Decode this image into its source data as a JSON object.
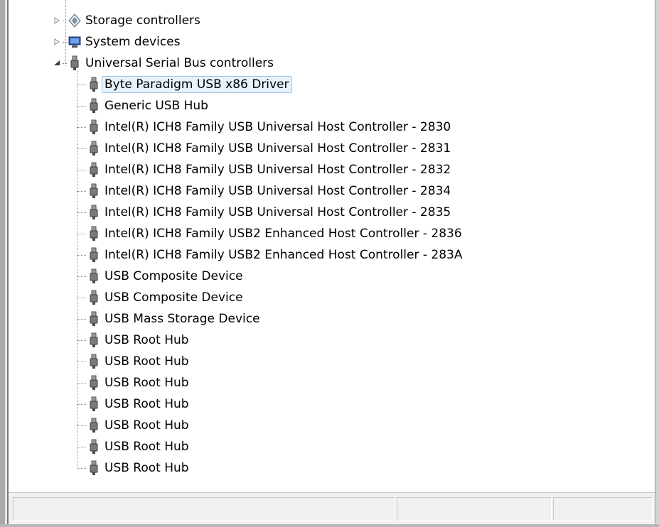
{
  "tree": {
    "categories": [
      {
        "label": "Storage controllers",
        "icon": "storage-controller-icon",
        "expanded": false
      },
      {
        "label": "System devices",
        "icon": "system-devices-icon",
        "expanded": false
      },
      {
        "label": "Universal Serial Bus controllers",
        "icon": "usb-plug-icon",
        "expanded": true
      }
    ],
    "usb_devices": [
      {
        "label": "Byte Paradigm USB x86 Driver",
        "selected": true
      },
      {
        "label": "Generic USB Hub"
      },
      {
        "label": "Intel(R) ICH8 Family USB Universal Host Controller - 2830"
      },
      {
        "label": "Intel(R) ICH8 Family USB Universal Host Controller - 2831"
      },
      {
        "label": "Intel(R) ICH8 Family USB Universal Host Controller - 2832"
      },
      {
        "label": "Intel(R) ICH8 Family USB Universal Host Controller - 2834"
      },
      {
        "label": "Intel(R) ICH8 Family USB Universal Host Controller - 2835"
      },
      {
        "label": "Intel(R) ICH8 Family USB2 Enhanced Host Controller - 2836"
      },
      {
        "label": "Intel(R) ICH8 Family USB2 Enhanced Host Controller - 283A"
      },
      {
        "label": "USB Composite Device"
      },
      {
        "label": "USB Composite Device"
      },
      {
        "label": "USB Mass Storage Device"
      },
      {
        "label": "USB Root Hub"
      },
      {
        "label": "USB Root Hub"
      },
      {
        "label": "USB Root Hub"
      },
      {
        "label": "USB Root Hub"
      },
      {
        "label": "USB Root Hub"
      },
      {
        "label": "USB Root Hub"
      },
      {
        "label": "USB Root Hub"
      }
    ]
  },
  "statusbar": {
    "cells": [
      "",
      "",
      ""
    ]
  },
  "colors": {
    "selection_bg": "#e8f2fb",
    "selection_border": "#99c7ef",
    "tree_line": "#8f8f8f"
  }
}
